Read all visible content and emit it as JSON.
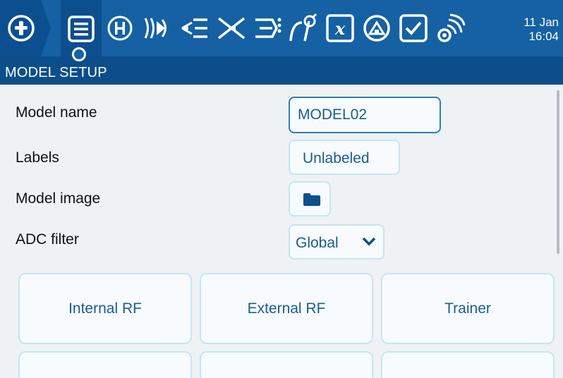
{
  "topbar": {
    "date": "11 Jan",
    "time": "16:04",
    "tabs": [
      {
        "name": "model-setup",
        "icon": "list-icon",
        "active": true
      },
      {
        "name": "heli",
        "icon": "heli-h-icon"
      },
      {
        "name": "flight-modes",
        "icon": "flight-modes-icon"
      },
      {
        "name": "inputs",
        "icon": "inputs-icon"
      },
      {
        "name": "mixes",
        "icon": "mixer-icon"
      },
      {
        "name": "outputs",
        "icon": "outputs-icon"
      },
      {
        "name": "curves",
        "icon": "curves-icon"
      },
      {
        "name": "gvars",
        "icon": "gvars-x-icon"
      },
      {
        "name": "logical-switches",
        "icon": "logical-switches-icon"
      },
      {
        "name": "special-functions",
        "icon": "special-functions-icon"
      },
      {
        "name": "telemetry",
        "icon": "telemetry-icon"
      }
    ]
  },
  "page": {
    "title": "MODEL SETUP"
  },
  "form": {
    "model_name_label": "Model name",
    "model_name_value": "MODEL02",
    "labels_label": "Labels",
    "labels_value": "Unlabeled",
    "model_image_label": "Model image",
    "adc_filter_label": "ADC filter",
    "adc_filter_value": "Global"
  },
  "buttons": {
    "internal_rf": "Internal RF",
    "external_rf": "External RF",
    "trainer": "Trainer"
  },
  "colors": {
    "topbar": "#1561a3",
    "active_tab": "#0b4f8f",
    "title_strip": "#0d4e8a",
    "background": "#eef2f5",
    "field_text": "#1c5b93"
  }
}
